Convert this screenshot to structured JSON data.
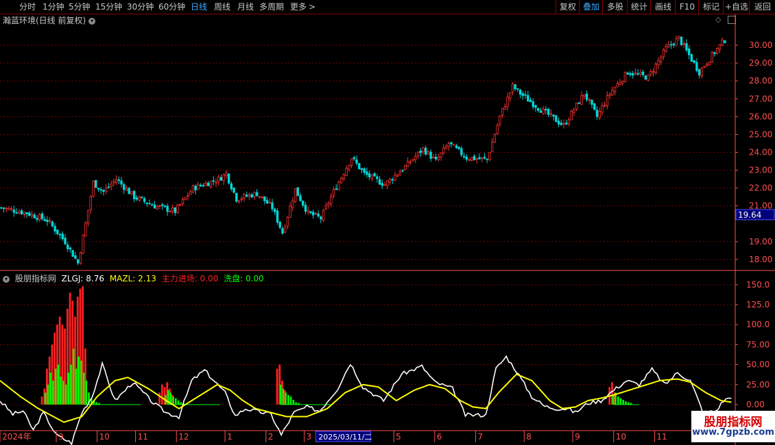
{
  "toolbar": {
    "left": [
      {
        "label": "分时",
        "x": 28
      },
      {
        "label": "1分钟",
        "x": 62
      },
      {
        "label": "5分钟",
        "x": 100
      },
      {
        "label": "15分钟",
        "x": 139
      },
      {
        "label": "30分钟",
        "x": 185
      },
      {
        "label": "60分钟",
        "x": 231
      },
      {
        "label": "日线",
        "x": 278,
        "active": true
      },
      {
        "label": "周线",
        "x": 312
      },
      {
        "label": "月线",
        "x": 346
      },
      {
        "label": "多周期",
        "x": 378
      },
      {
        "label": "更多",
        "x": 423
      }
    ],
    "more_arrow": ">",
    "right": [
      {
        "label": "复权",
        "x": 810,
        "w": 34
      },
      {
        "label": "叠加",
        "x": 844,
        "w": 34,
        "active": true
      },
      {
        "label": "多股",
        "x": 878,
        "w": 36
      },
      {
        "label": "统计",
        "x": 914,
        "w": 34
      },
      {
        "label": "画线",
        "x": 948,
        "w": 36
      },
      {
        "label": "F10",
        "x": 984,
        "w": 34
      },
      {
        "label": "标记",
        "x": 1018,
        "w": 36
      },
      {
        "label": "+自选",
        "x": 1054,
        "w": 38
      },
      {
        "label": "返回",
        "x": 1092,
        "w": 38
      }
    ]
  },
  "stock_title": "瀚蓝环境(日线 前复权)",
  "icons": {
    "menu": "chevron-down-icon",
    "diamond": "◇",
    "restore": "window-restore-icon"
  },
  "indicator": {
    "name": "股朋指标网",
    "zlgj": "ZLGJ: 8.76",
    "mazl": "MAZL: 2.13",
    "zhuli": "主力进场: 0.00",
    "xipan": "洗盘: 0.00"
  },
  "colors": {
    "up": "#ff3333",
    "down": "#00d7d7",
    "white": "#ffffff",
    "yellow": "#ffff00",
    "red": "#ff2020",
    "green": "#00ff00",
    "grid": "#7a0000",
    "axis": "#ff5050",
    "label_bg": "#00007a"
  },
  "price_label": "19.64",
  "watermark": {
    "line1": "股朋指标网",
    "line2": "www.7gpzb.com"
  },
  "chart_data": {
    "type": "candlestick",
    "price_axis": {
      "ticks": [
        "30.00",
        "29.00",
        "28.00",
        "27.00",
        "26.00",
        "25.00",
        "24.00",
        "23.00",
        "22.00",
        "21.00",
        "19.00",
        "18.00"
      ],
      "values": [
        30,
        29,
        28,
        27,
        26,
        25,
        24,
        23,
        22,
        21,
        19,
        18
      ],
      "ylim": [
        17.5,
        31.0
      ]
    },
    "indicator_axis": {
      "ticks": [
        "150.0",
        "125.0",
        "100.0",
        "75.00",
        "50.00",
        "25.00",
        "0.00"
      ],
      "values": [
        150,
        125,
        100,
        75,
        50,
        25,
        0
      ],
      "ylim": [
        -30,
        155
      ]
    },
    "date_labels": [
      "2024年",
      "9",
      "10",
      "11",
      "12",
      "1",
      "2",
      "3",
      "2025/03/11/二",
      "5",
      "6",
      "7",
      "8",
      "9",
      "10",
      "11"
    ],
    "date_label_days": [
      0,
      22,
      38,
      53,
      69,
      88,
      104,
      119,
      124,
      154,
      170,
      186,
      205,
      224,
      240,
      256
    ],
    "close_keypoints": [
      [
        0,
        20.9
      ],
      [
        10,
        20.6
      ],
      [
        18,
        20.2
      ],
      [
        25,
        19.0
      ],
      [
        30,
        17.8
      ],
      [
        33,
        20.0
      ],
      [
        36,
        22.3
      ],
      [
        40,
        21.8
      ],
      [
        45,
        22.5
      ],
      [
        52,
        21.5
      ],
      [
        60,
        21.0
      ],
      [
        68,
        20.7
      ],
      [
        75,
        22.0
      ],
      [
        85,
        22.5
      ],
      [
        88,
        22.8
      ],
      [
        92,
        21.4
      ],
      [
        100,
        21.7
      ],
      [
        106,
        20.9
      ],
      [
        110,
        19.5
      ],
      [
        115,
        21.9
      ],
      [
        120,
        20.6
      ],
      [
        125,
        20.3
      ],
      [
        130,
        21.8
      ],
      [
        137,
        23.7
      ],
      [
        142,
        22.8
      ],
      [
        150,
        22.2
      ],
      [
        158,
        23.2
      ],
      [
        165,
        24.2
      ],
      [
        170,
        23.5
      ],
      [
        175,
        24.5
      ],
      [
        182,
        23.7
      ],
      [
        190,
        23.6
      ],
      [
        195,
        26.0
      ],
      [
        200,
        27.7
      ],
      [
        203,
        27.3
      ],
      [
        210,
        26.5
      ],
      [
        220,
        25.5
      ],
      [
        228,
        27.3
      ],
      [
        233,
        26.0
      ],
      [
        238,
        27.3
      ],
      [
        245,
        28.5
      ],
      [
        253,
        28.2
      ],
      [
        260,
        29.8
      ],
      [
        265,
        30.4
      ],
      [
        270,
        29.2
      ],
      [
        273,
        28.5
      ],
      [
        280,
        29.8
      ],
      [
        283,
        30.3
      ]
    ],
    "white_line_keypoints": [
      [
        0,
        5
      ],
      [
        5,
        -12
      ],
      [
        9,
        -8
      ],
      [
        13,
        -32
      ],
      [
        17,
        -10
      ],
      [
        22,
        -38
      ],
      [
        28,
        -48
      ],
      [
        32,
        -10
      ],
      [
        36,
        10
      ],
      [
        40,
        50
      ],
      [
        45,
        5
      ],
      [
        52,
        28
      ],
      [
        60,
        2
      ],
      [
        65,
        -10
      ],
      [
        70,
        -15
      ],
      [
        75,
        30
      ],
      [
        80,
        43
      ],
      [
        88,
        15
      ],
      [
        92,
        -14
      ],
      [
        96,
        -5
      ],
      [
        100,
        -8
      ],
      [
        106,
        -12
      ],
      [
        110,
        -38
      ],
      [
        115,
        -10
      ],
      [
        120,
        -3
      ],
      [
        125,
        -8
      ],
      [
        132,
        20
      ],
      [
        137,
        52
      ],
      [
        142,
        22
      ],
      [
        150,
        5
      ],
      [
        157,
        38
      ],
      [
        165,
        48
      ],
      [
        170,
        28
      ],
      [
        177,
        20
      ],
      [
        182,
        -13
      ],
      [
        190,
        -13
      ],
      [
        194,
        45
      ],
      [
        198,
        60
      ],
      [
        202,
        42
      ],
      [
        208,
        10
      ],
      [
        213,
        -2
      ],
      [
        218,
        -5
      ],
      [
        222,
        -5
      ],
      [
        225,
        -10
      ],
      [
        230,
        2
      ],
      [
        235,
        5
      ],
      [
        240,
        18
      ],
      [
        245,
        30
      ],
      [
        250,
        25
      ],
      [
        255,
        44
      ],
      [
        260,
        25
      ],
      [
        265,
        40
      ],
      [
        270,
        30
      ],
      [
        275,
        -10
      ],
      [
        280,
        -8
      ],
      [
        283,
        5
      ],
      [
        286,
        10
      ]
    ],
    "yellow_line_keypoints": [
      [
        0,
        30
      ],
      [
        8,
        10
      ],
      [
        15,
        -5
      ],
      [
        25,
        -22
      ],
      [
        32,
        -15
      ],
      [
        38,
        10
      ],
      [
        45,
        30
      ],
      [
        50,
        34
      ],
      [
        58,
        20
      ],
      [
        65,
        5
      ],
      [
        70,
        -5
      ],
      [
        75,
        5
      ],
      [
        80,
        15
      ],
      [
        85,
        25
      ],
      [
        90,
        18
      ],
      [
        95,
        5
      ],
      [
        100,
        -5
      ],
      [
        106,
        -10
      ],
      [
        112,
        -15
      ],
      [
        120,
        -15
      ],
      [
        128,
        -5
      ],
      [
        135,
        15
      ],
      [
        142,
        25
      ],
      [
        148,
        22
      ],
      [
        155,
        5
      ],
      [
        162,
        18
      ],
      [
        168,
        25
      ],
      [
        174,
        20
      ],
      [
        180,
        5
      ],
      [
        185,
        -3
      ],
      [
        190,
        -5
      ],
      [
        195,
        15
      ],
      [
        202,
        38
      ],
      [
        208,
        30
      ],
      [
        215,
        5
      ],
      [
        220,
        -5
      ],
      [
        225,
        -3
      ],
      [
        230,
        5
      ],
      [
        235,
        8
      ],
      [
        240,
        12
      ],
      [
        250,
        22
      ],
      [
        258,
        30
      ],
      [
        265,
        32
      ],
      [
        270,
        28
      ],
      [
        276,
        15
      ],
      [
        282,
        5
      ],
      [
        286,
        3
      ]
    ],
    "red_bars": [
      [
        16,
        10
      ],
      [
        17,
        20
      ],
      [
        18,
        45
      ],
      [
        19,
        60
      ],
      [
        20,
        75
      ],
      [
        21,
        90
      ],
      [
        22,
        100
      ],
      [
        23,
        110
      ],
      [
        24,
        100
      ],
      [
        25,
        95
      ],
      [
        26,
        120
      ],
      [
        27,
        140
      ],
      [
        28,
        130
      ],
      [
        29,
        110
      ],
      [
        30,
        135
      ],
      [
        31,
        145
      ],
      [
        32,
        148
      ],
      [
        33,
        70
      ],
      [
        62,
        15
      ],
      [
        63,
        25
      ],
      [
        64,
        22
      ],
      [
        65,
        28
      ],
      [
        66,
        20
      ],
      [
        67,
        12
      ],
      [
        108,
        45
      ],
      [
        109,
        50
      ],
      [
        110,
        30
      ],
      [
        111,
        18
      ],
      [
        238,
        22
      ],
      [
        239,
        28
      ],
      [
        240,
        15
      ]
    ],
    "green_bars": [
      [
        17,
        15
      ],
      [
        18,
        25
      ],
      [
        19,
        40
      ],
      [
        20,
        30
      ],
      [
        21,
        45
      ],
      [
        22,
        50
      ],
      [
        23,
        35
      ],
      [
        24,
        30
      ],
      [
        25,
        25
      ],
      [
        26,
        40
      ],
      [
        27,
        50
      ],
      [
        28,
        70
      ],
      [
        29,
        45
      ],
      [
        30,
        60
      ],
      [
        31,
        55
      ],
      [
        32,
        40
      ],
      [
        33,
        30
      ],
      [
        34,
        15
      ],
      [
        35,
        8
      ],
      [
        36,
        5
      ],
      [
        37,
        3
      ],
      [
        38,
        2
      ],
      [
        64,
        12
      ],
      [
        65,
        18
      ],
      [
        66,
        15
      ],
      [
        67,
        10
      ],
      [
        68,
        8
      ],
      [
        69,
        5
      ],
      [
        70,
        3
      ],
      [
        71,
        2
      ],
      [
        72,
        1
      ],
      [
        109,
        25
      ],
      [
        110,
        20
      ],
      [
        111,
        15
      ],
      [
        112,
        12
      ],
      [
        113,
        10
      ],
      [
        114,
        6
      ],
      [
        115,
        3
      ],
      [
        116,
        2
      ],
      [
        239,
        12
      ],
      [
        240,
        15
      ],
      [
        241,
        10
      ],
      [
        242,
        8
      ],
      [
        243,
        6
      ],
      [
        244,
        4
      ],
      [
        245,
        3
      ],
      [
        246,
        2
      ]
    ],
    "baseline_segments": [
      [
        33,
        55
      ],
      [
        66,
        86
      ],
      [
        110,
        130
      ],
      [
        240,
        250
      ]
    ]
  }
}
